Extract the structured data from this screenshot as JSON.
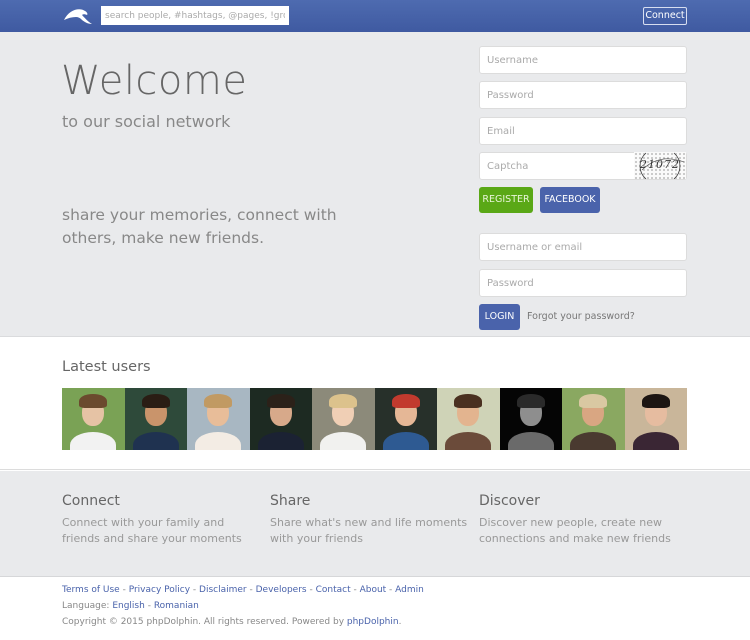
{
  "header": {
    "logo": "dolphin-logo",
    "search_placeholder": "search people, #hashtags, @pages, !groups",
    "connect_label": "Connect"
  },
  "hero": {
    "title": "Welcome",
    "subtitle": "to our social network",
    "tagline": "share your memories, connect with others, make new friends."
  },
  "register_form": {
    "username_placeholder": "Username",
    "password_placeholder": "Password",
    "email_placeholder": "Email",
    "captcha_placeholder": "Captcha",
    "captcha_code": "21072",
    "register_label": "REGISTER",
    "facebook_label": "FACEBOOK"
  },
  "login_form": {
    "username_placeholder": "Username or email",
    "password_placeholder": "Password",
    "login_label": "LOGIN",
    "forgot_label": "Forgot your password?"
  },
  "latest_users": {
    "title": "Latest users",
    "users": [
      {
        "bg": "#7aa255",
        "skin": "#e6c3a5",
        "hair": "#6b4a2e",
        "shirt": "#f2f2f2"
      },
      {
        "bg": "#2e4a3a",
        "skin": "#c9946b",
        "hair": "#2a1d14",
        "shirt": "#1f3250"
      },
      {
        "bg": "#a8b7c2",
        "skin": "#e8bd99",
        "hair": "#c19a63",
        "shirt": "#f3ece4"
      },
      {
        "bg": "#1d2a22",
        "skin": "#d7a98a",
        "hair": "#2b2119",
        "shirt": "#1b2233"
      },
      {
        "bg": "#8c8a7a",
        "skin": "#f0cfb5",
        "hair": "#dcc28c",
        "shirt": "#f1f1ef"
      },
      {
        "bg": "#27302a",
        "skin": "#e5b796",
        "hair": "#c23a2e",
        "shirt": "#2e5a92"
      },
      {
        "bg": "#cfd3b7",
        "skin": "#e3b48f",
        "hair": "#4a3020",
        "shirt": "#6b4b3a"
      },
      {
        "bg": "#050505",
        "skin": "#8e8e8e",
        "hair": "#2a2a2a",
        "shirt": "#6a6a6a"
      },
      {
        "bg": "#8aa861",
        "skin": "#d9a682",
        "hair": "#d9c8a2",
        "shirt": "#4a3a30"
      },
      {
        "bg": "#c9b69a",
        "skin": "#e6bca0",
        "hair": "#1c1512",
        "shirt": "#3a2634"
      }
    ]
  },
  "features": [
    {
      "title": "Connect",
      "text": "Connect with your family and friends and share your moments"
    },
    {
      "title": "Share",
      "text": "Share what's new and life moments with your friends"
    },
    {
      "title": "Discover",
      "text": "Discover new people, create new connections and make new friends"
    }
  ],
  "footer": {
    "links": [
      "Terms of Use",
      "Privacy Policy",
      "Disclaimer",
      "Developers",
      "Contact",
      "About",
      "Admin"
    ],
    "separator": " - ",
    "language_label": "Language:",
    "languages": [
      "English",
      "Romanian"
    ],
    "copyright_text": "Copyright © 2015 phpDolphin. All rights reserved. Powered by",
    "powered_link": "phpDolphin",
    "period": "."
  },
  "colors": {
    "header_blue": "#4a63ab",
    "register_green": "#5aa816",
    "link_blue": "#4a63ab"
  }
}
